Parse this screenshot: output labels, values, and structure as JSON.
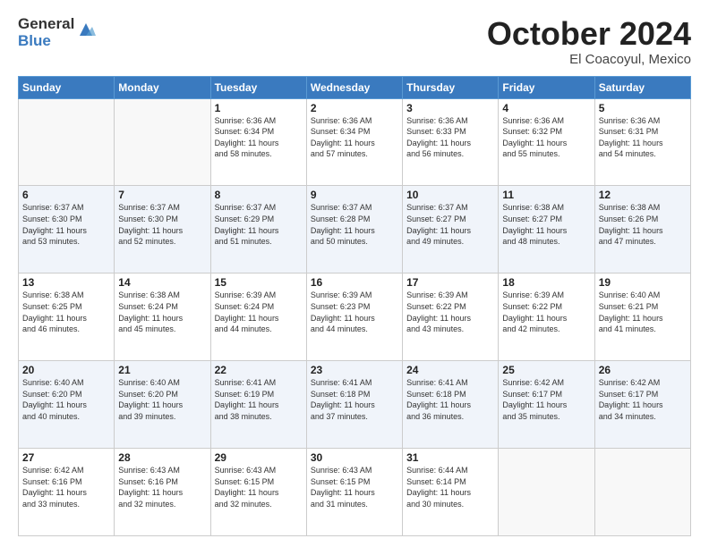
{
  "header": {
    "logo_general": "General",
    "logo_blue": "Blue",
    "month_title": "October 2024",
    "location": "El Coacoyul, Mexico"
  },
  "weekdays": [
    "Sunday",
    "Monday",
    "Tuesday",
    "Wednesday",
    "Thursday",
    "Friday",
    "Saturday"
  ],
  "weeks": [
    [
      {
        "day": "",
        "info": ""
      },
      {
        "day": "",
        "info": ""
      },
      {
        "day": "1",
        "info": "Sunrise: 6:36 AM\nSunset: 6:34 PM\nDaylight: 11 hours\nand 58 minutes."
      },
      {
        "day": "2",
        "info": "Sunrise: 6:36 AM\nSunset: 6:34 PM\nDaylight: 11 hours\nand 57 minutes."
      },
      {
        "day": "3",
        "info": "Sunrise: 6:36 AM\nSunset: 6:33 PM\nDaylight: 11 hours\nand 56 minutes."
      },
      {
        "day": "4",
        "info": "Sunrise: 6:36 AM\nSunset: 6:32 PM\nDaylight: 11 hours\nand 55 minutes."
      },
      {
        "day": "5",
        "info": "Sunrise: 6:36 AM\nSunset: 6:31 PM\nDaylight: 11 hours\nand 54 minutes."
      }
    ],
    [
      {
        "day": "6",
        "info": "Sunrise: 6:37 AM\nSunset: 6:30 PM\nDaylight: 11 hours\nand 53 minutes."
      },
      {
        "day": "7",
        "info": "Sunrise: 6:37 AM\nSunset: 6:30 PM\nDaylight: 11 hours\nand 52 minutes."
      },
      {
        "day": "8",
        "info": "Sunrise: 6:37 AM\nSunset: 6:29 PM\nDaylight: 11 hours\nand 51 minutes."
      },
      {
        "day": "9",
        "info": "Sunrise: 6:37 AM\nSunset: 6:28 PM\nDaylight: 11 hours\nand 50 minutes."
      },
      {
        "day": "10",
        "info": "Sunrise: 6:37 AM\nSunset: 6:27 PM\nDaylight: 11 hours\nand 49 minutes."
      },
      {
        "day": "11",
        "info": "Sunrise: 6:38 AM\nSunset: 6:27 PM\nDaylight: 11 hours\nand 48 minutes."
      },
      {
        "day": "12",
        "info": "Sunrise: 6:38 AM\nSunset: 6:26 PM\nDaylight: 11 hours\nand 47 minutes."
      }
    ],
    [
      {
        "day": "13",
        "info": "Sunrise: 6:38 AM\nSunset: 6:25 PM\nDaylight: 11 hours\nand 46 minutes."
      },
      {
        "day": "14",
        "info": "Sunrise: 6:38 AM\nSunset: 6:24 PM\nDaylight: 11 hours\nand 45 minutes."
      },
      {
        "day": "15",
        "info": "Sunrise: 6:39 AM\nSunset: 6:24 PM\nDaylight: 11 hours\nand 44 minutes."
      },
      {
        "day": "16",
        "info": "Sunrise: 6:39 AM\nSunset: 6:23 PM\nDaylight: 11 hours\nand 44 minutes."
      },
      {
        "day": "17",
        "info": "Sunrise: 6:39 AM\nSunset: 6:22 PM\nDaylight: 11 hours\nand 43 minutes."
      },
      {
        "day": "18",
        "info": "Sunrise: 6:39 AM\nSunset: 6:22 PM\nDaylight: 11 hours\nand 42 minutes."
      },
      {
        "day": "19",
        "info": "Sunrise: 6:40 AM\nSunset: 6:21 PM\nDaylight: 11 hours\nand 41 minutes."
      }
    ],
    [
      {
        "day": "20",
        "info": "Sunrise: 6:40 AM\nSunset: 6:20 PM\nDaylight: 11 hours\nand 40 minutes."
      },
      {
        "day": "21",
        "info": "Sunrise: 6:40 AM\nSunset: 6:20 PM\nDaylight: 11 hours\nand 39 minutes."
      },
      {
        "day": "22",
        "info": "Sunrise: 6:41 AM\nSunset: 6:19 PM\nDaylight: 11 hours\nand 38 minutes."
      },
      {
        "day": "23",
        "info": "Sunrise: 6:41 AM\nSunset: 6:18 PM\nDaylight: 11 hours\nand 37 minutes."
      },
      {
        "day": "24",
        "info": "Sunrise: 6:41 AM\nSunset: 6:18 PM\nDaylight: 11 hours\nand 36 minutes."
      },
      {
        "day": "25",
        "info": "Sunrise: 6:42 AM\nSunset: 6:17 PM\nDaylight: 11 hours\nand 35 minutes."
      },
      {
        "day": "26",
        "info": "Sunrise: 6:42 AM\nSunset: 6:17 PM\nDaylight: 11 hours\nand 34 minutes."
      }
    ],
    [
      {
        "day": "27",
        "info": "Sunrise: 6:42 AM\nSunset: 6:16 PM\nDaylight: 11 hours\nand 33 minutes."
      },
      {
        "day": "28",
        "info": "Sunrise: 6:43 AM\nSunset: 6:16 PM\nDaylight: 11 hours\nand 32 minutes."
      },
      {
        "day": "29",
        "info": "Sunrise: 6:43 AM\nSunset: 6:15 PM\nDaylight: 11 hours\nand 32 minutes."
      },
      {
        "day": "30",
        "info": "Sunrise: 6:43 AM\nSunset: 6:15 PM\nDaylight: 11 hours\nand 31 minutes."
      },
      {
        "day": "31",
        "info": "Sunrise: 6:44 AM\nSunset: 6:14 PM\nDaylight: 11 hours\nand 30 minutes."
      },
      {
        "day": "",
        "info": ""
      },
      {
        "day": "",
        "info": ""
      }
    ]
  ]
}
